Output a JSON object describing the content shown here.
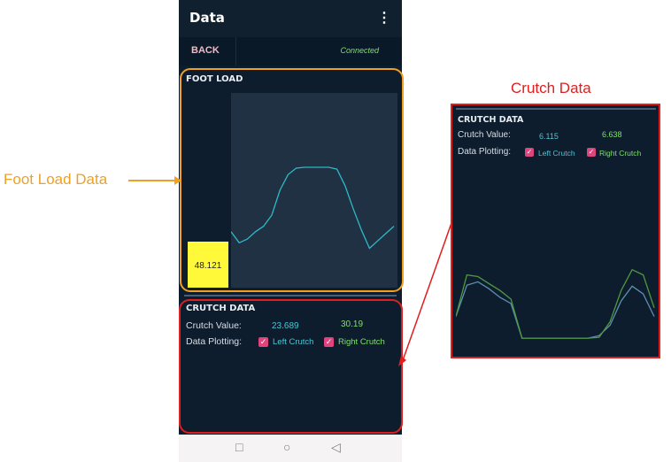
{
  "app": {
    "title": "Data",
    "menu_glyph": "⋮",
    "back_label": "BACK",
    "status": "Connected"
  },
  "foot_load": {
    "title": "FOOT LOAD",
    "value": "48.121",
    "series": [
      0.3,
      0.18,
      0.22,
      0.3,
      0.36,
      0.48,
      0.75,
      0.92,
      0.99,
      1.0,
      1.0,
      1.0,
      1.0,
      0.98,
      0.8,
      0.55,
      0.32,
      0.12,
      0.2,
      0.28,
      0.36
    ]
  },
  "crutch": {
    "title": "CRUTCH DATA",
    "value_label": "Crutch Value:",
    "left_value": "23.689",
    "right_value": "30.19",
    "plot_label": "Data Plotting:",
    "left_label": "Left Crutch",
    "right_label": "Right Crutch",
    "check_glyph": "✓"
  },
  "navbar": {
    "square": "□",
    "circle": "○",
    "back": "◁"
  },
  "annotations": {
    "foot_load_label": "Foot Load Data",
    "arrow_glyph": "⟶",
    "crutch_label": "Crutch Data"
  },
  "inset": {
    "title": "CRUTCH DATA",
    "value_label": "Crutch Value:",
    "left_value": "6.115",
    "right_value": "6.638",
    "plot_label": "Data Plotting:",
    "left_label": "Left Crutch",
    "right_label": "Right Crutch",
    "left_series": [
      0.3,
      0.66,
      0.7,
      0.62,
      0.52,
      0.45,
      0.05,
      0.05,
      0.05,
      0.05,
      0.05,
      0.05,
      0.05,
      0.08,
      0.2,
      0.48,
      0.65,
      0.56,
      0.3
    ],
    "right_series": [
      0.3,
      0.78,
      0.76,
      0.68,
      0.6,
      0.5,
      0.05,
      0.05,
      0.05,
      0.05,
      0.05,
      0.05,
      0.05,
      0.06,
      0.24,
      0.6,
      0.84,
      0.78,
      0.4
    ]
  },
  "colors": {
    "background": "#0e1d2e",
    "foot_line": "#2fb9c6",
    "left_crutch": "#5c8fb0",
    "right_crutch": "#4f9a3e",
    "left_label": "#47c6d4",
    "right_label": "#7ee06a",
    "foot_outline": "#f0a020",
    "crutch_outline": "#e01e1e",
    "load_box": "#fff93a"
  }
}
